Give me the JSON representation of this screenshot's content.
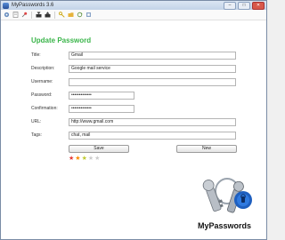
{
  "window": {
    "title": "MyPasswords 3.6",
    "controls": [
      "–",
      "□",
      "✕"
    ]
  },
  "toolbar": {
    "icons": [
      "gear-icon",
      "document-icon",
      "pin-icon",
      "import-icon",
      "export-icon",
      "key-icon",
      "folder-icon",
      "reload-icon",
      "settings-icon"
    ]
  },
  "form": {
    "title": "Update Password",
    "fields": [
      {
        "label": "Title:",
        "value": "Gmail"
      },
      {
        "label": "Description:",
        "value": "Google mail service"
      },
      {
        "label": "Username:",
        "value": ""
      },
      {
        "label": "Password:",
        "value": "•••••••••••••"
      },
      {
        "label": "Confirmation:",
        "value": "•••••••••••••"
      },
      {
        "label": "URL:",
        "value": "http://www.gmail.com"
      },
      {
        "label": "Tags:",
        "value": "chat, mail"
      }
    ],
    "save_label": "Save",
    "new_label": "New",
    "strength_rating": 3,
    "strength_max": 5,
    "star_colors": [
      "#e53935",
      "#fb8c00",
      "#c0ca33",
      "#cccccc",
      "#cccccc"
    ]
  },
  "logo": {
    "text": "MyPasswords"
  }
}
